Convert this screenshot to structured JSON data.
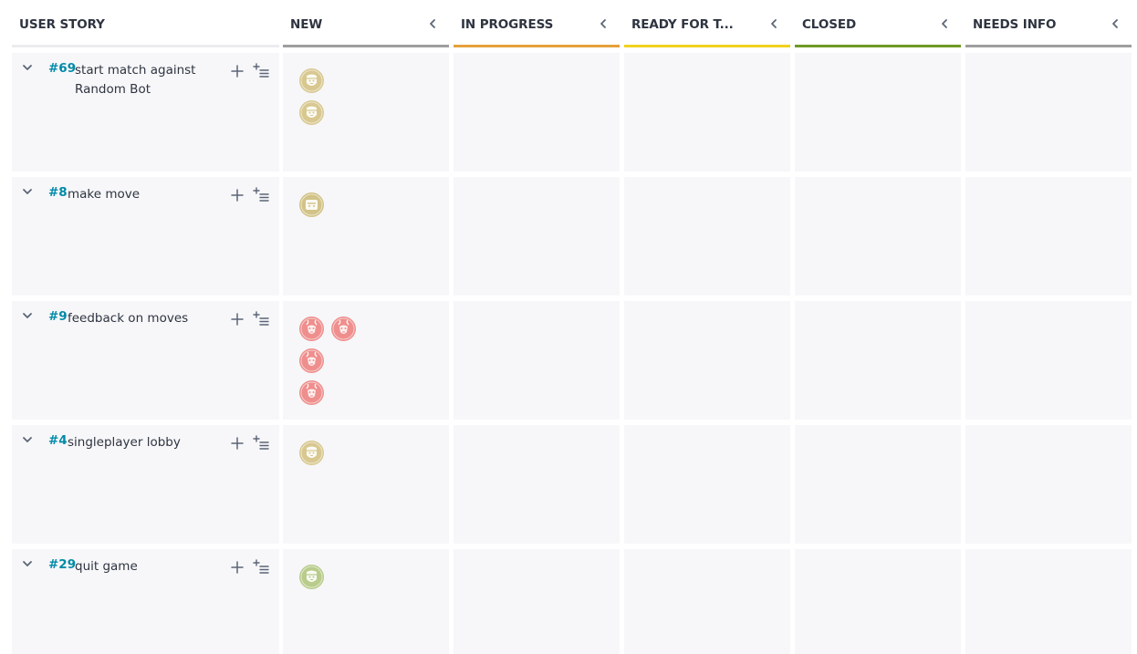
{
  "board": {
    "story_column_label": "USER STORY",
    "columns": [
      {
        "label": "NEW",
        "color": "#9e9e9e"
      },
      {
        "label": "IN PROGRESS",
        "color": "#e5a03c"
      },
      {
        "label": "READY FOR T...",
        "color": "#f0d21e"
      },
      {
        "label": "CLOSED",
        "color": "#6f9a25"
      },
      {
        "label": "NEEDS INFO",
        "color": "#9e9e9e"
      }
    ]
  },
  "stories": [
    {
      "ref": "#69",
      "name": "start match against Random Bot",
      "tasks": [
        {
          "avatar": "beige"
        },
        {
          "avatar": "beige"
        }
      ]
    },
    {
      "ref": "#8",
      "name": "make move",
      "tasks": [
        {
          "avatar": "beige-face"
        }
      ]
    },
    {
      "ref": "#9",
      "name": "feedback on moves",
      "tasks": [
        {
          "avatar": "pink"
        },
        {
          "avatar": "pink"
        },
        {
          "avatar": "pink"
        },
        {
          "avatar": "pink"
        }
      ]
    },
    {
      "ref": "#4",
      "name": "singleplayer lobby",
      "tasks": [
        {
          "avatar": "beige"
        }
      ]
    },
    {
      "ref": "#29",
      "name": "quit game",
      "tasks": [
        {
          "avatar": "green"
        }
      ]
    }
  ],
  "avatar_colors": {
    "beige": "#d8c890",
    "beige-face": "#d2c388",
    "pink": "#ee8f8d",
    "green": "#b9cc8c"
  },
  "icons": {
    "toggle": "chevron-down-icon",
    "add": "plus-icon",
    "bulk": "add-bulk-icon",
    "collapse": "chevron-left-icon"
  }
}
